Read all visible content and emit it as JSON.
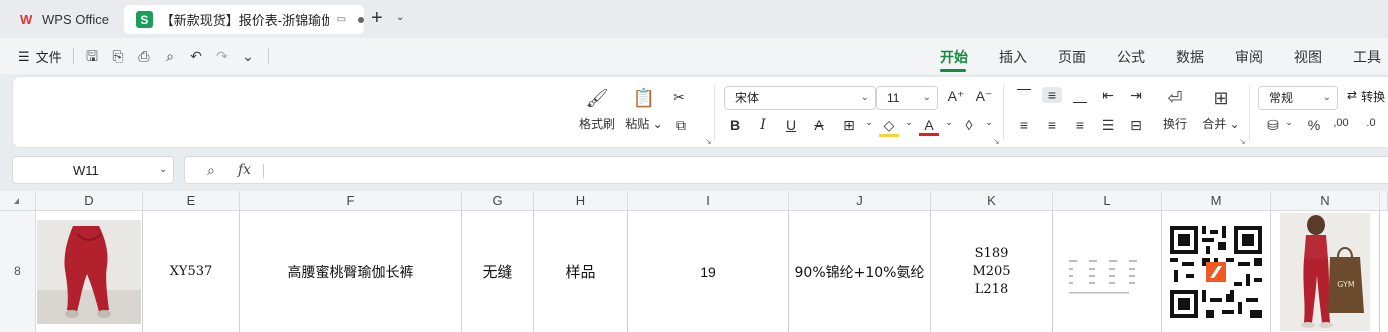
{
  "titlebar": {
    "app_name": "WPS Office",
    "doc_tab_title": "【新款现货】报价表-浙锦瑜伽",
    "doc_icon_letter": "S"
  },
  "menu": {
    "file_label": "文件",
    "tabs": [
      "开始",
      "插入",
      "页面",
      "公式",
      "数据",
      "审阅",
      "视图",
      "工具"
    ],
    "active_tab": "开始"
  },
  "ribbon": {
    "format_painter": "格式刷",
    "paste": "粘贴",
    "font_name": "宋体",
    "font_size": "11",
    "wrap": "换行",
    "merge": "合并",
    "number_format": "常规",
    "convert": "转换",
    "colors": {
      "fill": "#f5d33b",
      "font": "#e02020",
      "accent": "#168a3e"
    }
  },
  "formula_bar": {
    "name_box": "W11",
    "fx_label": "fx",
    "content": ""
  },
  "sheet": {
    "columns": [
      "D",
      "E",
      "F",
      "G",
      "H",
      "I",
      "J",
      "K",
      "L",
      "M",
      "N"
    ],
    "row_number": "8",
    "row": {
      "E": "XY537",
      "F": "高腰蜜桃臀瑜伽长裤",
      "G": "无缝",
      "H": "样品",
      "I": "19",
      "J": "90%锦纶+10%氨纶",
      "K": [
        "S189",
        "M205",
        "L218"
      ]
    }
  }
}
